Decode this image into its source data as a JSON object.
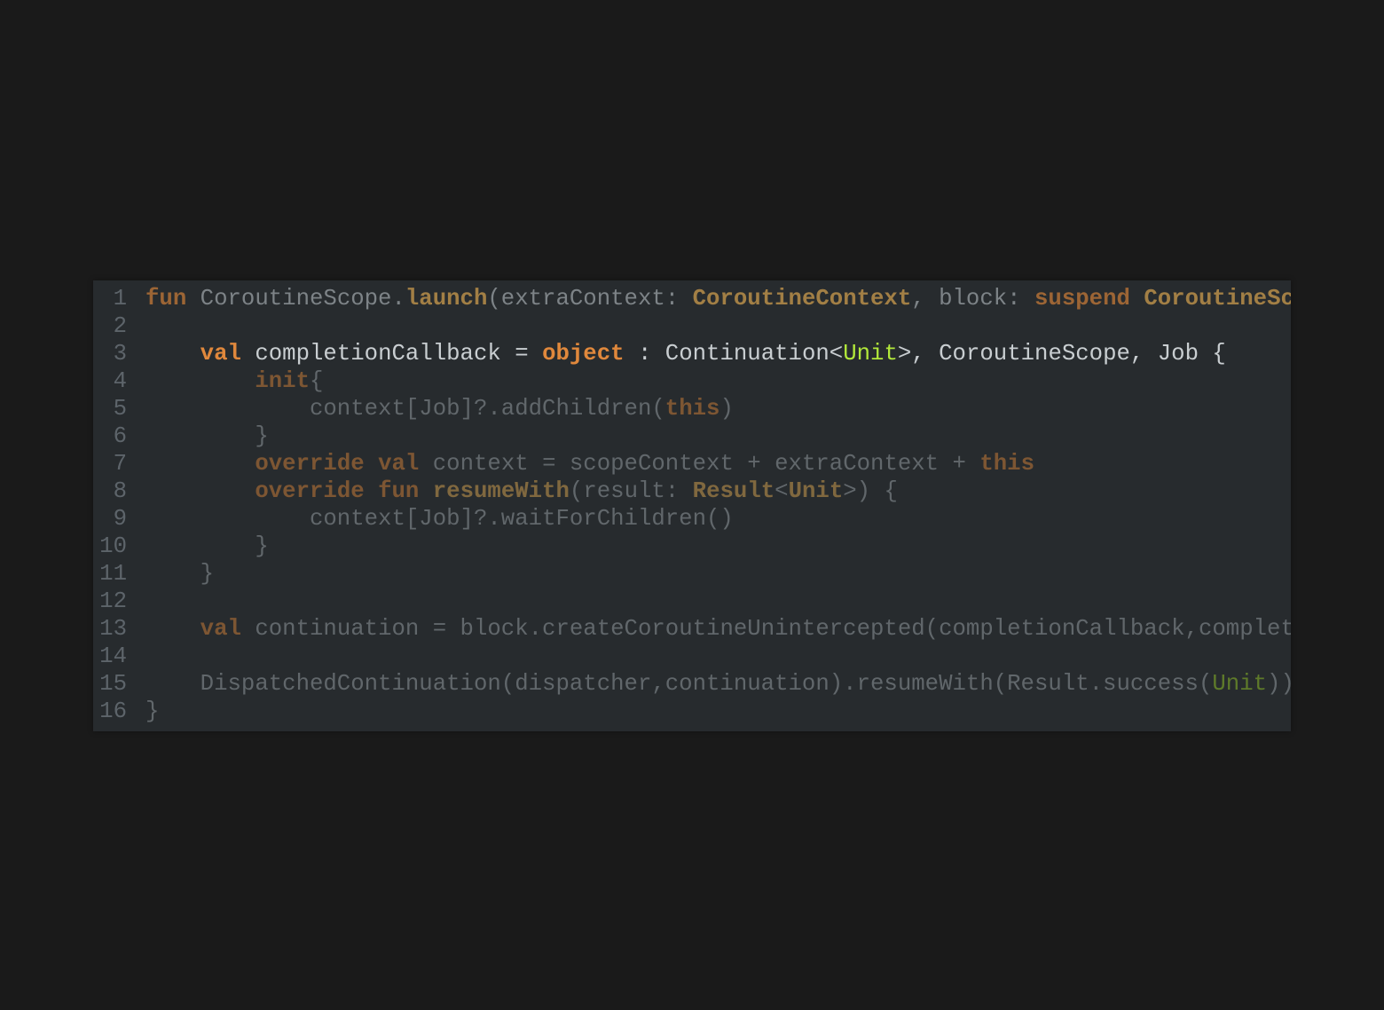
{
  "editor": {
    "language": "kotlin",
    "lines": [
      {
        "n": "1",
        "cls": "mid",
        "tokens": [
          {
            "t": "fun",
            "c": "kw"
          },
          {
            "t": " CoroutineScope.",
            "c": "tok"
          },
          {
            "t": "launch",
            "c": "fn"
          },
          {
            "t": "(extraContext: ",
            "c": "tok"
          },
          {
            "t": "CoroutineContext",
            "c": "ty"
          },
          {
            "t": ", block: ",
            "c": "tok"
          },
          {
            "t": "suspend",
            "c": "kw"
          },
          {
            "t": " ",
            "c": "tok"
          },
          {
            "t": "CoroutineScope",
            "c": "ty"
          }
        ]
      },
      {
        "n": "2",
        "cls": "dim",
        "tokens": []
      },
      {
        "n": "3",
        "cls": "focus",
        "tokens": [
          {
            "t": "    ",
            "c": "tok"
          },
          {
            "t": "val",
            "c": "kw"
          },
          {
            "t": " completionCallback = ",
            "c": "tok"
          },
          {
            "t": "object",
            "c": "kw"
          },
          {
            "t": " : Continuation<",
            "c": "tok"
          },
          {
            "t": "Unit",
            "c": "gr"
          },
          {
            "t": ">, CoroutineScope, Job {",
            "c": "tok"
          }
        ]
      },
      {
        "n": "4",
        "cls": "dim",
        "tokens": [
          {
            "t": "        ",
            "c": "tok"
          },
          {
            "t": "init",
            "c": "kw"
          },
          {
            "t": "{",
            "c": "tok"
          }
        ]
      },
      {
        "n": "5",
        "cls": "dim",
        "tokens": [
          {
            "t": "            context[Job]?.addChildren(",
            "c": "tok"
          },
          {
            "t": "this",
            "c": "kw"
          },
          {
            "t": ")",
            "c": "tok"
          }
        ]
      },
      {
        "n": "6",
        "cls": "dim",
        "tokens": [
          {
            "t": "        }",
            "c": "tok"
          }
        ]
      },
      {
        "n": "7",
        "cls": "dim",
        "tokens": [
          {
            "t": "        ",
            "c": "tok"
          },
          {
            "t": "override",
            "c": "kw"
          },
          {
            "t": " ",
            "c": "tok"
          },
          {
            "t": "val",
            "c": "kw"
          },
          {
            "t": " context = scopeContext + extraContext + ",
            "c": "tok"
          },
          {
            "t": "this",
            "c": "kw"
          }
        ]
      },
      {
        "n": "8",
        "cls": "dim",
        "tokens": [
          {
            "t": "        ",
            "c": "tok"
          },
          {
            "t": "override",
            "c": "kw"
          },
          {
            "t": " ",
            "c": "tok"
          },
          {
            "t": "fun",
            "c": "kw"
          },
          {
            "t": " ",
            "c": "tok"
          },
          {
            "t": "resumeWith",
            "c": "fn"
          },
          {
            "t": "(result: ",
            "c": "tok"
          },
          {
            "t": "Result",
            "c": "ty"
          },
          {
            "t": "<",
            "c": "tok"
          },
          {
            "t": "Unit",
            "c": "ty"
          },
          {
            "t": ">) {",
            "c": "tok"
          }
        ]
      },
      {
        "n": "9",
        "cls": "dim",
        "tokens": [
          {
            "t": "            context[Job]?.waitForChildren()",
            "c": "tok"
          }
        ]
      },
      {
        "n": "10",
        "cls": "dim",
        "tokens": [
          {
            "t": "        }",
            "c": "tok"
          }
        ]
      },
      {
        "n": "11",
        "cls": "dim",
        "tokens": [
          {
            "t": "    }",
            "c": "tok"
          }
        ]
      },
      {
        "n": "12",
        "cls": "dim",
        "tokens": []
      },
      {
        "n": "13",
        "cls": "dim",
        "tokens": [
          {
            "t": "    ",
            "c": "tok"
          },
          {
            "t": "val",
            "c": "kw"
          },
          {
            "t": " continuation = block.createCoroutineUnintercepted(completionCallback,completionCallback)",
            "c": "tok"
          }
        ]
      },
      {
        "n": "14",
        "cls": "dim",
        "tokens": []
      },
      {
        "n": "15",
        "cls": "dim",
        "tokens": [
          {
            "t": "    DispatchedContinuation(dispatcher,continuation).resumeWith(Result.success(",
            "c": "tok"
          },
          {
            "t": "Unit",
            "c": "gr"
          },
          {
            "t": "))",
            "c": "tok"
          }
        ]
      },
      {
        "n": "16",
        "cls": "dim",
        "tokens": [
          {
            "t": "}",
            "c": "tok"
          }
        ]
      }
    ]
  }
}
